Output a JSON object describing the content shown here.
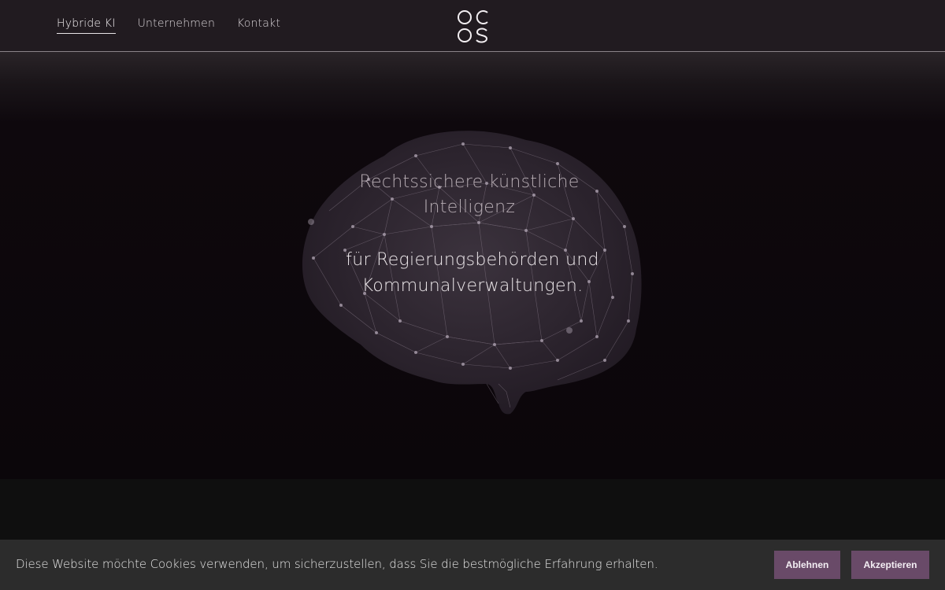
{
  "nav": {
    "items": [
      {
        "label": "Hybride KI",
        "active": true
      },
      {
        "label": "Unternehmen",
        "active": false
      },
      {
        "label": "Kontakt",
        "active": false
      }
    ]
  },
  "logo": {
    "text": "OC OS"
  },
  "hero": {
    "title": "Rechtssichere künstliche Intelligenz",
    "subtitle": "für Regierungsbehörden und Kommunalverwaltungen."
  },
  "cookie": {
    "message": "Diese Website möchte Cookies verwenden, um sicherzustellen, dass Sie die bestmögliche Erfahrung erhalten.",
    "decline_label": "Ablehnen",
    "accept_label": "Akzeptieren"
  },
  "colors": {
    "header_bg": "#211b20",
    "hero_bg": "#0b060a",
    "button_bg": "#694a68",
    "cookie_bg": "#2c2c2c"
  }
}
